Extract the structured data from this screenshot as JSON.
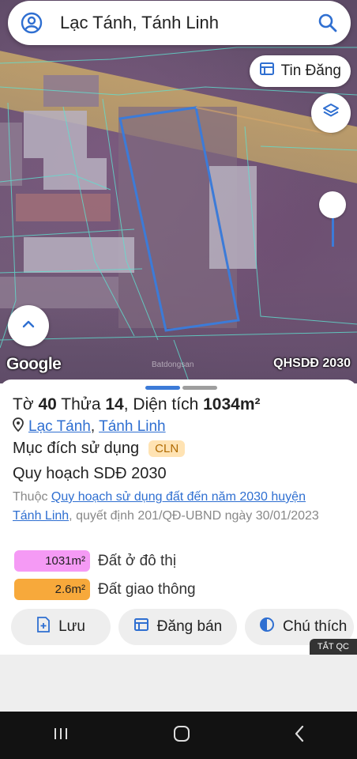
{
  "search": {
    "query": "Lạc Tánh, Tánh Linh"
  },
  "map": {
    "tin_dang_label": "Tin Đăng",
    "google_logo": "Google",
    "layer_label": "QHSDĐ 2030",
    "watermark": "Batdongsan"
  },
  "parcel": {
    "sheet_prefix": "Tờ",
    "sheet_no": "40",
    "plot_prefix": "Thửa",
    "plot_no": "14",
    "area_prefix": ", Diện tích",
    "area": "1034m²",
    "location_commune": "Lạc Tánh",
    "location_sep": ",",
    "location_district": "Tánh Linh",
    "purpose_label": "Mục đích sử dụng",
    "purpose_code": "CLN",
    "plan_title": "Quy hoạch SDĐ 2030",
    "desc_prefix": "Thuộc",
    "desc_link1": "Quy hoạch sử dụng đất đến năm 2030 huyện",
    "desc_link2": "Tánh Linh",
    "desc_suffix": ", quyết định 201/QĐ-UBND ngày 30/01/2023"
  },
  "land_use": [
    {
      "value": "1031m²",
      "label": "Đất ở đô thị",
      "color": "#f59af5"
    },
    {
      "value": "2.6m²",
      "label": "Đất giao thông",
      "color": "#f7a93b"
    }
  ],
  "actions": {
    "save": "Lưu",
    "post_sale": "Đăng bán",
    "legend": "Chú thích"
  },
  "ad_tag": "TẮT QC",
  "colors": {
    "accent": "#3c7bd8",
    "link": "#2f6fd1"
  }
}
